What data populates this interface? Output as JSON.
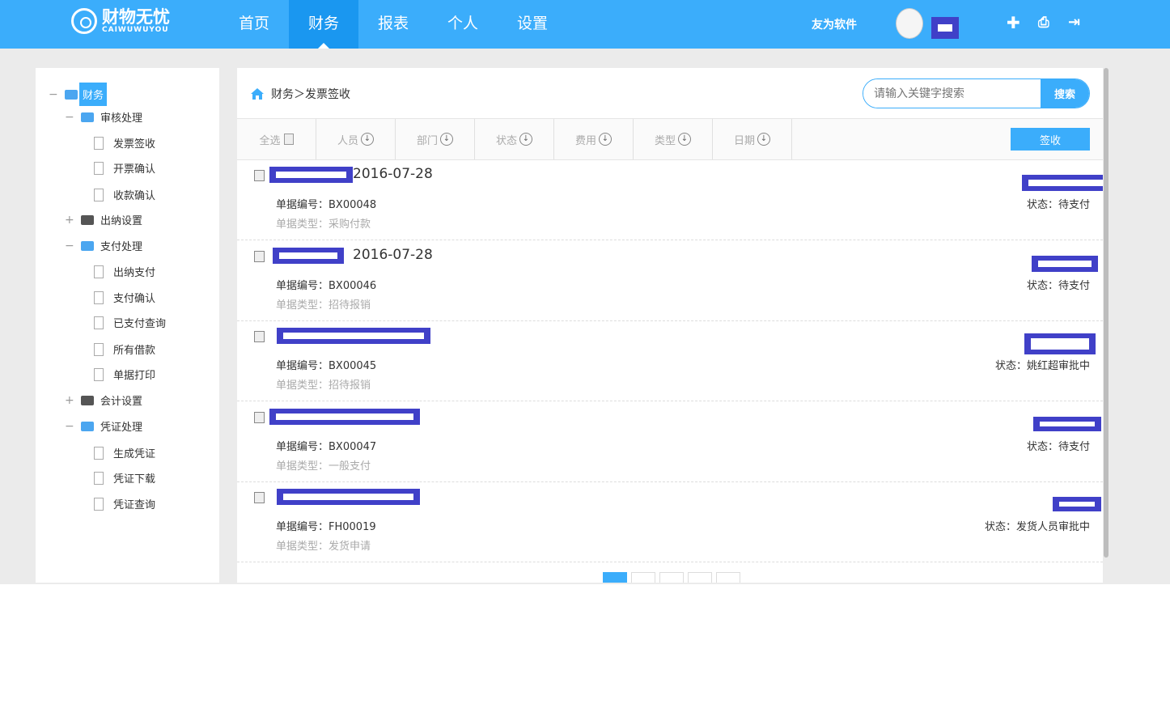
{
  "header": {
    "logo_title": "财物无忧",
    "logo_sub": "CAIWUWUYOU",
    "nav": [
      "首页",
      "财务",
      "报表",
      "个人",
      "设置"
    ],
    "active_nav": 1,
    "company": "友为软件"
  },
  "sidebar": {
    "items": [
      {
        "label": "财务",
        "level": 0,
        "type": "root",
        "toggle": "−"
      },
      {
        "label": "审核处理",
        "level": 1,
        "type": "folder",
        "toggle": "−"
      },
      {
        "label": "发票签收",
        "level": 2,
        "type": "file"
      },
      {
        "label": "开票确认",
        "level": 2,
        "type": "file"
      },
      {
        "label": "收款确认",
        "level": 2,
        "type": "file"
      },
      {
        "label": "出纳设置",
        "level": 1,
        "type": "folder-closed",
        "toggle": "+"
      },
      {
        "label": "支付处理",
        "level": 1,
        "type": "folder",
        "toggle": "−"
      },
      {
        "label": "出纳支付",
        "level": 2,
        "type": "file"
      },
      {
        "label": "支付确认",
        "level": 2,
        "type": "file"
      },
      {
        "label": "已支付查询",
        "level": 2,
        "type": "file"
      },
      {
        "label": "所有借款",
        "level": 2,
        "type": "file"
      },
      {
        "label": "单据打印",
        "level": 2,
        "type": "file"
      },
      {
        "label": "会计设置",
        "level": 1,
        "type": "folder-closed",
        "toggle": "+"
      },
      {
        "label": "凭证处理",
        "level": 1,
        "type": "folder",
        "toggle": "−"
      },
      {
        "label": "生成凭证",
        "level": 2,
        "type": "file"
      },
      {
        "label": "凭证下载",
        "level": 2,
        "type": "file"
      },
      {
        "label": "凭证查询",
        "level": 2,
        "type": "file"
      }
    ]
  },
  "breadcrumb": {
    "text": "财务＞发票签收"
  },
  "search": {
    "placeholder": "请输入关键字搜索",
    "button": "搜索"
  },
  "toolbar": {
    "select_all": "全选",
    "columns": [
      "人员",
      "部门",
      "状态",
      "费用",
      "类型",
      "日期"
    ],
    "sign_button": "签收"
  },
  "records": [
    {
      "date": "2016-07-28",
      "no": "单据编号：BX00048",
      "type": "单据类型：采购付款",
      "status": "状态：待支付"
    },
    {
      "date": "2016-07-28",
      "no": "单据编号：BX00046",
      "type": "单据类型：招待报销",
      "status": "状态：待支付"
    },
    {
      "date": "",
      "no": "单据编号：BX00045",
      "type": "单据类型：招待报销",
      "status": "状态：姚红超审批中"
    },
    {
      "date": "",
      "no": "单据编号：BX00047",
      "type": "单据类型：一般支付",
      "status": "状态：待支付"
    },
    {
      "date": "",
      "no": "单据编号：FH00019",
      "type": "单据类型：发货申请",
      "status": "状态：发货人员审批中"
    }
  ],
  "pagination": {
    "current": 1,
    "pages": 5
  }
}
